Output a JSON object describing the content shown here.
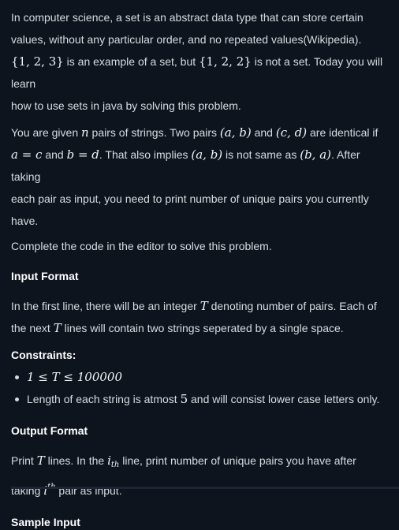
{
  "intro": {
    "l1": "In computer science, a set is an abstract data type that can store certain",
    "l2": "values, without any particular order, and no repeated values(Wikipedia).",
    "set_ok": "{1, 2, 3}",
    "l3a": " is an example of a set, but ",
    "set_bad": "{1, 2, 2}",
    "l3b": " is not a set. Today you will learn",
    "l4": "how to use sets in java by solving this problem."
  },
  "task": {
    "a1": "You are given ",
    "n": "n",
    "a2": " pairs of strings. Two pairs ",
    "ab": "(a, b)",
    "a3": " and ",
    "cd": "(c, d)",
    "a4": " are identical if",
    "eq1": "a = c",
    "b1": " and ",
    "eq2": "b = d",
    "b2": ". That also implies ",
    "ab2": "(a, b)",
    "b3": " is not same as ",
    "ba": "(b, a)",
    "b4": ". After taking",
    "c1": "each pair as input, you need to print number of unique pairs you currently",
    "d1": "have."
  },
  "complete": "Complete the code in the editor to solve this problem.",
  "input_format": {
    "heading": "Input Format",
    "a1": "In the first line, there will be an integer ",
    "T": "T",
    "a2": " denoting number of pairs. Each of",
    "b1": "the next ",
    "T2": "T",
    "b2": " lines will contain two strings seperated by a single space."
  },
  "constraints": {
    "heading": "Constraints:",
    "item1": "1 ≤ T ≤ 100000",
    "item2a": "Length of each string is atmost ",
    "item2n": "5",
    "item2b": " and will consist lower case letters only."
  },
  "output_format": {
    "heading": "Output Format",
    "a1": "Print ",
    "T": "T",
    "a2": " lines. In the ",
    "i": "i",
    "isub": "th",
    "a3": " line, print number of unique pairs you have after",
    "b1": "taking ",
    "i2": "i",
    "isup": "th",
    "b2": " pair as input."
  },
  "sample_input_heading": "Sample Input"
}
